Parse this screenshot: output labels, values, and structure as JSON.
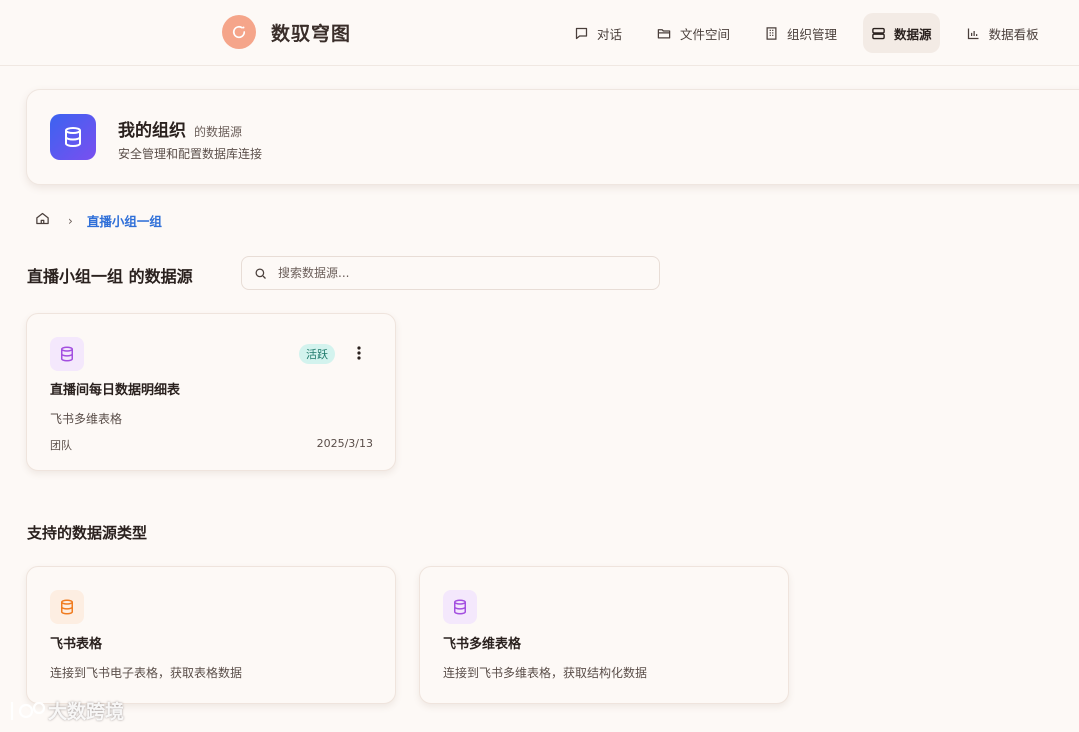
{
  "app": {
    "name": "数驭穹图"
  },
  "nav": [
    {
      "label": "对话",
      "icon": "chat-icon",
      "active": false
    },
    {
      "label": "文件空间",
      "icon": "folder-icon",
      "active": false
    },
    {
      "label": "组织管理",
      "icon": "building-icon",
      "active": false
    },
    {
      "label": "数据源",
      "icon": "server-icon",
      "active": true
    },
    {
      "label": "数据看板",
      "icon": "bar-chart-icon",
      "active": false
    }
  ],
  "hero": {
    "title": "我的组织",
    "title_suffix": "的数据源",
    "subtitle": "安全管理和配置数据库连接"
  },
  "breadcrumb": {
    "current": "直播小组一组"
  },
  "section": {
    "title": "直播小组一组 的数据源",
    "search_placeholder": "搜索数据源..."
  },
  "datasources": [
    {
      "name": "直播间每日数据明细表",
      "type": "飞书多维表格",
      "status": "活跃",
      "owner": "团队",
      "date": "2025/3/13",
      "icon": "database-icon"
    }
  ],
  "supported": {
    "title": "支持的数据源类型",
    "types": [
      {
        "name": "飞书表格",
        "description": "连接到飞书电子表格，获取表格数据",
        "icon": "database-icon",
        "color": "#f07b1f",
        "bg": "#fdeee2"
      },
      {
        "name": "飞书多维表格",
        "description": "连接到飞书多维表格，获取结构化数据",
        "icon": "database-icon",
        "color": "#a34fe0",
        "bg": "#f4e8fc"
      }
    ]
  },
  "watermark": {
    "text": "大数跨境"
  },
  "colors": {
    "accent": "#2f6fd8",
    "brand": "#f5a58a",
    "active_badge_bg": "#d3f3ee",
    "active_badge_text": "#1f7a6b"
  }
}
